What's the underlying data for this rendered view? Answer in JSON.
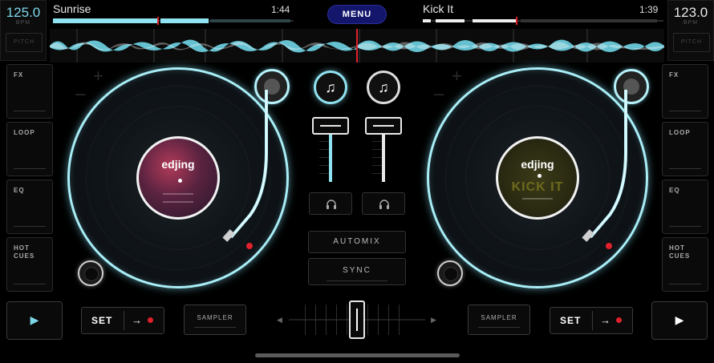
{
  "deck_a": {
    "bpm": "125.0",
    "bpm_unit": "BPM",
    "pitch_label": "PITCH",
    "track_title": "Sunrise",
    "time": "1:44",
    "label_brand": "edjing",
    "accent": "#7ed6ea"
  },
  "deck_b": {
    "bpm": "123.0",
    "bpm_unit": "BPM",
    "pitch_label": "PITCH",
    "track_title": "Kick It",
    "time": "1:39",
    "label_brand": "edjing",
    "label_text": "KICK IT"
  },
  "header": {
    "menu_label": "MENU"
  },
  "left_panel": [
    {
      "label": "FX"
    },
    {
      "label": "LOOP"
    },
    {
      "label": "EQ"
    },
    {
      "label": "HOT\nCUES"
    }
  ],
  "right_panel": [
    {
      "label": "FX"
    },
    {
      "label": "LOOP"
    },
    {
      "label": "EQ"
    },
    {
      "label": "HOT\nCUES"
    }
  ],
  "mixer": {
    "automix_label": "AUTOMIX",
    "sync_label": "SYNC",
    "volume_a_level": 1.0,
    "volume_b_level": 1.0,
    "crossfader_position": 0.5
  },
  "bottom": {
    "play_symbol": "▶",
    "set_label": "SET",
    "set_arrow": "→",
    "sampler_label": "SAMPLER",
    "xf_left_arrow": "◀",
    "xf_right_arrow": "▶"
  },
  "colors": {
    "cyan": "#7ed6ea",
    "red": "#e0212b",
    "white": "#e8e8e8",
    "menu_bg": "#13166b"
  },
  "icons": [
    "music-note-add-icon",
    "headphones-icon",
    "play-icon",
    "arrow-right-icon",
    "record-icon",
    "plus-icon",
    "minus-icon"
  ]
}
